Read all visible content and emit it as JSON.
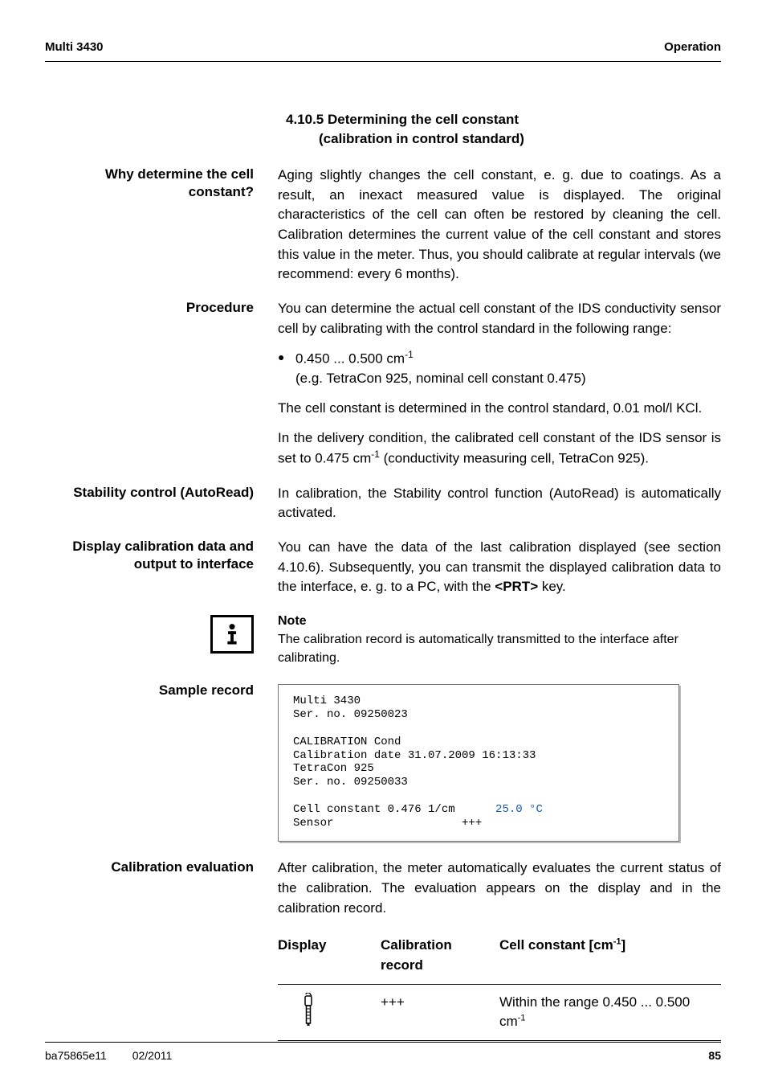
{
  "header": {
    "left": "Multi 3430",
    "right": "Operation"
  },
  "section_heading": {
    "number": "4.10.5",
    "title_line1": "Determining the cell constant",
    "title_line2": "(calibration in control standard)"
  },
  "blocks": {
    "why": {
      "label": "Why determine the cell constant?",
      "text": "Aging slightly changes the cell constant, e. g. due to coatings.  As a result, an inexact measured value is displayed. The original characteristics of the cell can often be restored by cleaning the cell. Calibration determines the current value of the cell constant and stores this value in the meter. Thus, you should calibrate at regular intervals (we recommend: every 6 months)."
    },
    "procedure": {
      "label": "Procedure",
      "intro": "You can determine the actual cell constant of the IDS conductivity sensor cell by calibrating with the control standard in the following range:",
      "bullet_line1": "0.450 ... 0.500 cm",
      "bullet_sup": "-1",
      "bullet_line2": "(e.g. TetraCon 925, nominal cell constant 0.475)",
      "after1": "The cell constant is determined in the control standard, 0.01 mol/l KCl.",
      "after2_part1": "In the delivery condition, the calibrated cell constant of the IDS sensor is set to 0.475 cm",
      "after2_sup": "-1",
      "after2_part2": " (conductivity measuring cell, TetraCon 925)."
    },
    "stability": {
      "label": "Stability control (AutoRead)",
      "text": "In calibration, the Stability control function (AutoRead) is automatically activated."
    },
    "display_cal": {
      "label": "Display calibration data and output to interface",
      "text_part1": "You can have the data of the last calibration displayed (see section 4.10.6). Subsequently, you can transmit the displayed calibration data to the interface, e. g. to a PC, with the ",
      "key": "<PRT>",
      "text_part2": " key."
    },
    "note": {
      "label": "Note",
      "text": "The calibration record is automatically transmitted to the interface after calibrating."
    },
    "sample": {
      "label": "Sample record",
      "lines": {
        "l1": "Multi 3430",
        "l2": "Ser. no. 09250023",
        "l3": "CALIBRATION Cond",
        "l4": "Calibration date 31.07.2009 16:13:33",
        "l5": "TetraCon 925",
        "l6": "Ser. no. 09250033",
        "l7a": "Cell constant 0.476 1/cm      ",
        "l7b": "25.0 °C",
        "l8": "Sensor                   +++"
      }
    },
    "cal_eval": {
      "label": "Calibration evaluation",
      "text": "After calibration, the meter automatically evaluates the current status of the calibration. The evaluation appears on the display and in the calibration record.",
      "table": {
        "head": {
          "c1": "Display",
          "c2": "Calibration record",
          "c3_part1": "Cell constant [cm",
          "c3_sup": "-1",
          "c3_part2": "]"
        },
        "row1": {
          "c2": "+++",
          "c3_part1": "Within the range 0.450 ... 0.500 cm",
          "c3_sup": "-1"
        }
      }
    }
  },
  "footer": {
    "code": "ba75865e11",
    "date": "02/2011",
    "page": "85"
  }
}
